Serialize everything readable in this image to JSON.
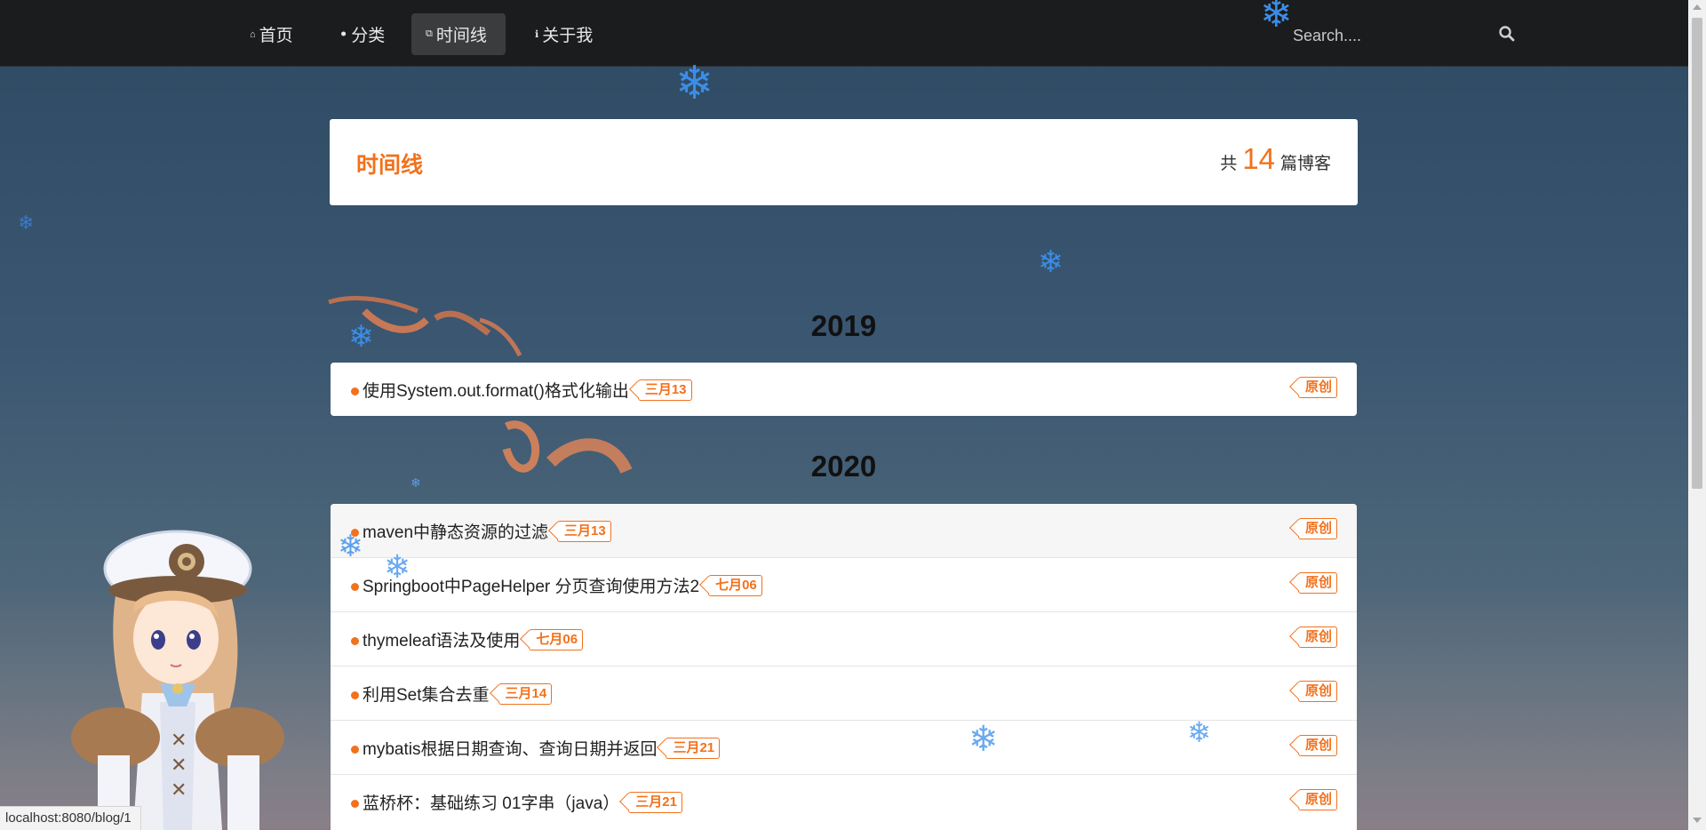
{
  "nav": {
    "items": [
      {
        "label": "首页",
        "icon": "home-icon"
      },
      {
        "label": "分类",
        "icon": "idea-icon"
      },
      {
        "label": "时间线",
        "icon": "clone-icon"
      },
      {
        "label": "关于我",
        "icon": "info-icon"
      }
    ],
    "active_index": 2,
    "search_placeholder": "Search...."
  },
  "header": {
    "title": "时间线",
    "count_prefix": "共",
    "count": "14",
    "count_suffix": "篇博客"
  },
  "timeline": [
    {
      "year": "2019",
      "posts": [
        {
          "title": "使用System.out.format()格式化输出",
          "date": "三月13",
          "type": "原创"
        }
      ]
    },
    {
      "year": "2020",
      "posts": [
        {
          "title": "maven中静态资源的过滤",
          "date": "三月13",
          "type": "原创"
        },
        {
          "title": "Springboot中PageHelper 分页查询使用方法2",
          "date": "七月06",
          "type": "原创"
        },
        {
          "title": "thymeleaf语法及使用",
          "date": "七月06",
          "type": "原创"
        },
        {
          "title": "利用Set集合去重",
          "date": "三月14",
          "type": "原创"
        },
        {
          "title": "mybatis根据日期查询、查询日期并返回",
          "date": "三月21",
          "type": "原创"
        },
        {
          "title": "蓝桥杯：基础练习 01字串（java）",
          "date": "三月21",
          "type": "原创"
        }
      ]
    }
  ],
  "status_bar": {
    "url": "localhost:8080/blog/1"
  },
  "colors": {
    "accent": "#f2711c",
    "navbar": "#1b1c1d",
    "snowflake": "#3b8ee8"
  }
}
